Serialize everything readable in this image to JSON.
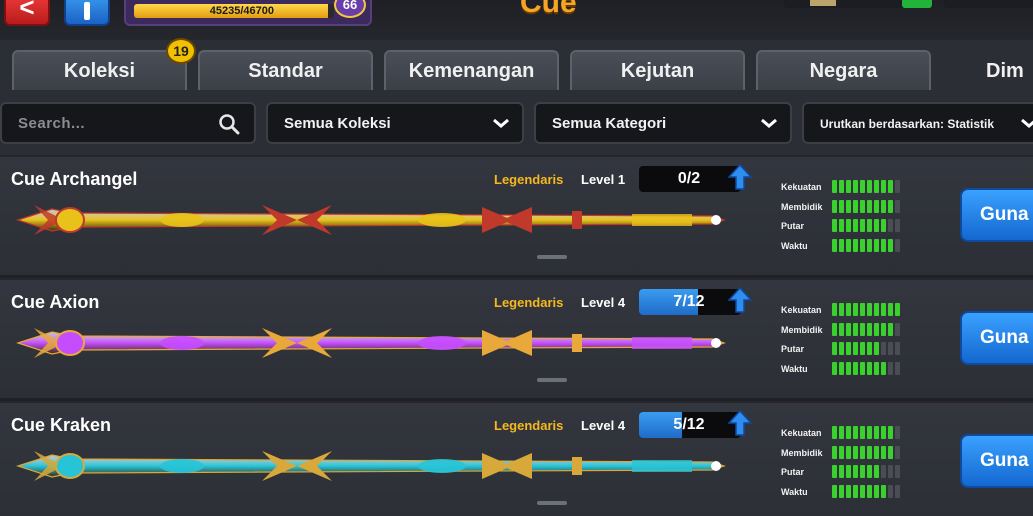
{
  "header": {
    "title": "Cue",
    "xp_text": "45235/46700",
    "xp_progress": 0.969,
    "player_level": "66"
  },
  "tabs": [
    {
      "label": "Koleksi",
      "badge": "19"
    },
    {
      "label": "Standar"
    },
    {
      "label": "Kemenangan"
    },
    {
      "label": "Kejutan"
    },
    {
      "label": "Negara"
    },
    {
      "label": "Dim"
    }
  ],
  "filters": {
    "search_placeholder": "Search...",
    "collection_label": "Semua Koleksi",
    "category_label": "Semua Kategori",
    "sort_label": "Urutkan berdasarkan: Statistik"
  },
  "stat_labels": {
    "force": "Kekuatan",
    "aim": "Membidik",
    "spin": "Putar",
    "time": "Waktu"
  },
  "cues": [
    {
      "name": "Cue Archangel",
      "rarity": "Legendaris",
      "level": "Level 1",
      "progress_text": "0/2",
      "progress": 0,
      "stats": {
        "force": 9,
        "aim": 9,
        "spin": 8,
        "time": 9
      },
      "stat_max": 10,
      "button": "Guna",
      "colors": {
        "primary": "#e8c21a",
        "accent": "#c0392b"
      }
    },
    {
      "name": "Cue Axion",
      "rarity": "Legendaris",
      "level": "Level 4",
      "progress_text": "7/12",
      "progress": 0.583,
      "stats": {
        "force": 10,
        "aim": 9,
        "spin": 7,
        "time": 8
      },
      "stat_max": 10,
      "button": "Guna",
      "colors": {
        "primary": "#c54dff",
        "accent": "#e8a93a"
      }
    },
    {
      "name": "Cue Kraken",
      "rarity": "Legendaris",
      "level": "Level 4",
      "progress_text": "5/12",
      "progress": 0.417,
      "stats": {
        "force": 9,
        "aim": 9,
        "spin": 7,
        "time": 8
      },
      "stat_max": 10,
      "button": "Guna",
      "colors": {
        "primary": "#27c4d8",
        "accent": "#d8a83a"
      }
    }
  ]
}
